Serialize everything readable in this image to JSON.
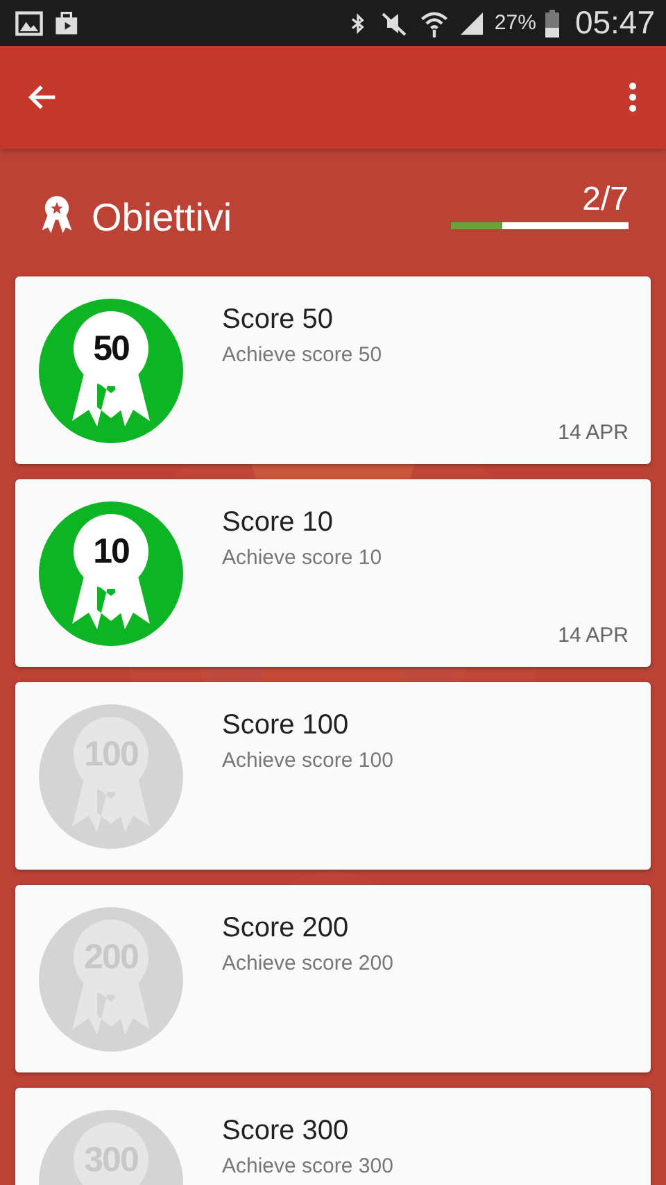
{
  "status_bar": {
    "battery": "27%",
    "time": "05:47"
  },
  "header": {
    "title": "Obiettivi",
    "progress_text": "2/7",
    "level": 0.29
  },
  "achievements": [
    {
      "badge": "50",
      "title": "Score 50",
      "description": "Achieve score 50",
      "unlocked": true,
      "date": "14 APR"
    },
    {
      "badge": "10",
      "title": "Score 10",
      "description": "Achieve score 10",
      "unlocked": true,
      "date": "14 APR"
    },
    {
      "badge": "100",
      "title": "Score 100",
      "description": "Achieve score 100",
      "unlocked": false
    },
    {
      "badge": "200",
      "title": "Score 200",
      "description": "Achieve score 200",
      "unlocked": false
    },
    {
      "badge": "300",
      "title": "Score 300",
      "description": "Achieve score 300",
      "unlocked": false
    }
  ]
}
